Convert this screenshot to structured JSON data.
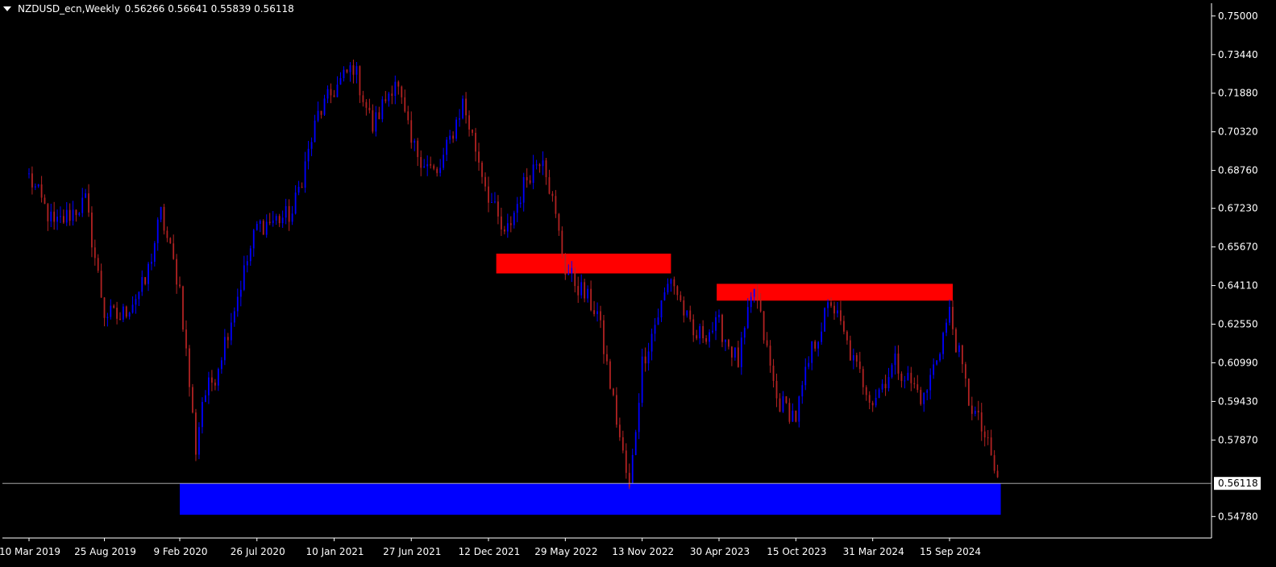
{
  "header": {
    "symbol": "NZDUSD_ecn,Weekly",
    "ohlc": "0.56266 0.56641 0.55839 0.56118"
  },
  "chart_data": {
    "type": "candlestick",
    "y_ticks": [
      "0.75000",
      "0.73440",
      "0.71880",
      "0.70320",
      "0.68760",
      "0.67230",
      "0.65670",
      "0.64110",
      "0.62550",
      "0.60990",
      "0.59430",
      "0.57870",
      "0.54780"
    ],
    "x_ticks": [
      "10 Mar 2019",
      "25 Aug 2019",
      "9 Feb 2020",
      "26 Jul 2020",
      "10 Jan 2021",
      "27 Jun 2021",
      "12 Dec 2021",
      "29 May 2022",
      "13 Nov 2022",
      "30 Apr 2023",
      "15 Oct 2023",
      "31 Mar 2024",
      "15 Sep 2024"
    ],
    "current_price": "0.56118",
    "ylim": [
      0.544,
      0.7545
    ],
    "colors": {
      "bull": "#0000ff",
      "bear": "#b22222",
      "bg": "#000000",
      "axis": "#ffffff"
    },
    "path": [
      [
        "10 Mar 2019",
        0.685
      ],
      [
        "5 May 2019",
        0.665
      ],
      [
        "14 Jul 2019",
        0.675
      ],
      [
        "25 Aug 2019",
        0.63
      ],
      [
        "29 Sep 2019",
        0.628
      ],
      [
        "24 Nov 2019",
        0.642
      ],
      [
        "29 Dec 2019",
        0.67
      ],
      [
        "9 Feb 2020",
        0.64
      ],
      [
        "15 Mar 2020",
        0.575
      ],
      [
        "29 Mar 2020",
        0.595
      ],
      [
        "26 Apr 2020",
        0.605
      ],
      [
        "26 Jul 2020",
        0.665
      ],
      [
        "11 Oct 2020",
        0.67
      ],
      [
        "6 Dec 2020",
        0.71
      ],
      [
        "10 Jan 2021",
        0.72
      ],
      [
        "21 Feb 2021",
        0.73
      ],
      [
        "4 Apr 2021",
        0.705
      ],
      [
        "23 May 2021",
        0.725
      ],
      [
        "27 Jun 2021",
        0.698
      ],
      [
        "22 Aug 2021",
        0.685
      ],
      [
        "17 Oct 2021",
        0.715
      ],
      [
        "12 Dec 2021",
        0.678
      ],
      [
        "16 Jan 2022",
        0.66
      ],
      [
        "6 Mar 2022",
        0.685
      ],
      [
        "10 Apr 2022",
        0.695
      ],
      [
        "29 May 2022",
        0.648
      ],
      [
        "7 Aug 2022",
        0.63
      ],
      [
        "16 Oct 2022",
        0.558
      ],
      [
        "13 Nov 2022",
        0.61
      ],
      [
        "15 Jan 2023",
        0.645
      ],
      [
        "5 Mar 2023",
        0.62
      ],
      [
        "30 Apr 2023",
        0.625
      ],
      [
        "11 Jun 2023",
        0.61
      ],
      [
        "16 Jul 2023",
        0.64
      ],
      [
        "3 Sep 2023",
        0.595
      ],
      [
        "15 Oct 2023",
        0.588
      ],
      [
        "19 Nov 2023",
        0.615
      ],
      [
        "31 Dec 2023",
        0.635
      ],
      [
        "18 Feb 2024",
        0.61
      ],
      [
        "31 Mar 2024",
        0.595
      ],
      [
        "19 May 2024",
        0.61
      ],
      [
        "21 Jul 2024",
        0.595
      ],
      [
        "15 Sep 2024",
        0.63
      ],
      [
        "27 Oct 2024",
        0.595
      ],
      [
        "1 Dec 2024",
        0.58
      ],
      [
        "29 Dec 2024",
        0.562
      ]
    ],
    "zones": [
      {
        "name": "resistance-zone-1",
        "color": "#ff0000",
        "from": "29 Dec 2021",
        "to": "15 Jan 2023",
        "high": 0.654,
        "low": 0.646
      },
      {
        "name": "resistance-zone-2",
        "color": "#ff0000",
        "from": "25 Apr 2023",
        "to": "22 Sep 2024",
        "high": 0.6418,
        "low": 0.635
      },
      {
        "name": "support-zone",
        "color": "#0000ff",
        "from": "9 Feb 2020",
        "to": "5 Jan 2025",
        "high": 0.5612,
        "low": 0.5485
      }
    ]
  }
}
